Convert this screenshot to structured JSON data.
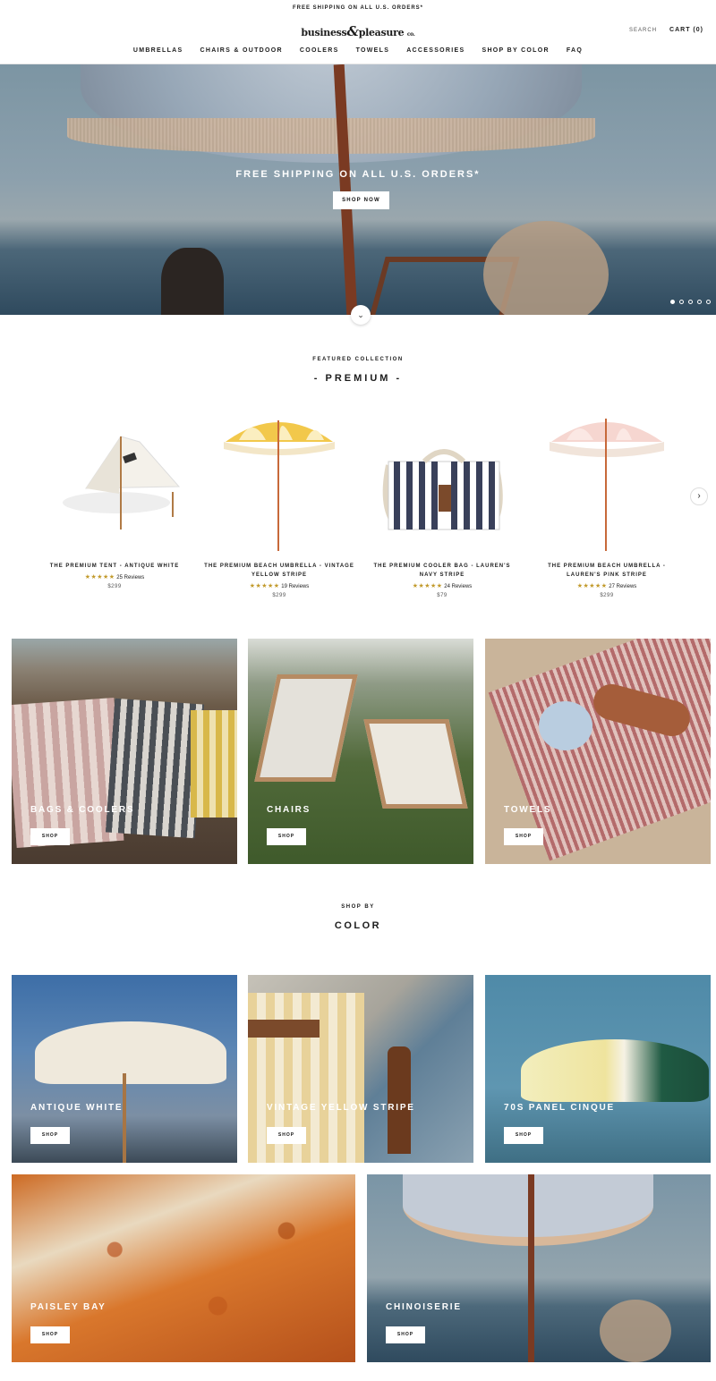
{
  "announcement": "FREE SHIPPING ON ALL U.S. ORDERS*",
  "header": {
    "logo_part1": "business",
    "logo_amp": "&",
    "logo_part2": "pleasure",
    "logo_suffix": "co.",
    "search_label": "SEARCH",
    "cart_label": "CART (0)",
    "nav": [
      "UMBRELLAS",
      "CHAIRS & OUTDOOR",
      "COOLERS",
      "TOWELS",
      "ACCESSORIES",
      "SHOP BY COLOR",
      "FAQ"
    ]
  },
  "hero": {
    "title": "FREE SHIPPING ON ALL U.S. ORDERS*",
    "button": "SHOP NOW",
    "slides": 5,
    "active_slide": 1
  },
  "featured": {
    "label": "FEATURED COLLECTION",
    "title": "- PREMIUM -",
    "products": [
      {
        "name": "THE PREMIUM TENT - ANTIQUE WHITE",
        "stars": "★★★★★",
        "reviews": "25 Reviews",
        "price": "$299"
      },
      {
        "name": "THE PREMIUM BEACH UMBRELLA - VINTAGE YELLOW STRIPE",
        "stars": "★★★★★",
        "reviews": "19 Reviews",
        "price": "$299"
      },
      {
        "name": "THE PREMIUM COOLER BAG - LAUREN'S NAVY STRIPE",
        "stars": "★★★★★",
        "reviews": "24 Reviews",
        "price": "$79"
      },
      {
        "name": "THE PREMIUM BEACH UMBRELLA - LAUREN'S PINK STRIPE",
        "stars": "★★★★★",
        "reviews": "27 Reviews",
        "price": "$299"
      }
    ]
  },
  "categories": [
    {
      "label": "BAGS & COOLERS",
      "button": "SHOP"
    },
    {
      "label": "CHAIRS",
      "button": "SHOP"
    },
    {
      "label": "TOWELS",
      "button": "SHOP"
    }
  ],
  "shop_by": {
    "label": "SHOP BY",
    "title": "COLOR",
    "colors": [
      {
        "label": "ANTIQUE WHITE",
        "button": "SHOP"
      },
      {
        "label": "VINTAGE YELLOW STRIPE",
        "button": "SHOP"
      },
      {
        "label": "70S PANEL CINQUE",
        "button": "SHOP"
      },
      {
        "label": "PAISLEY BAY",
        "button": "SHOP"
      },
      {
        "label": "CHINOISERIE",
        "button": "SHOP"
      }
    ]
  },
  "colors": {
    "star": "#c29a2c",
    "text": "#1c1c1c"
  }
}
